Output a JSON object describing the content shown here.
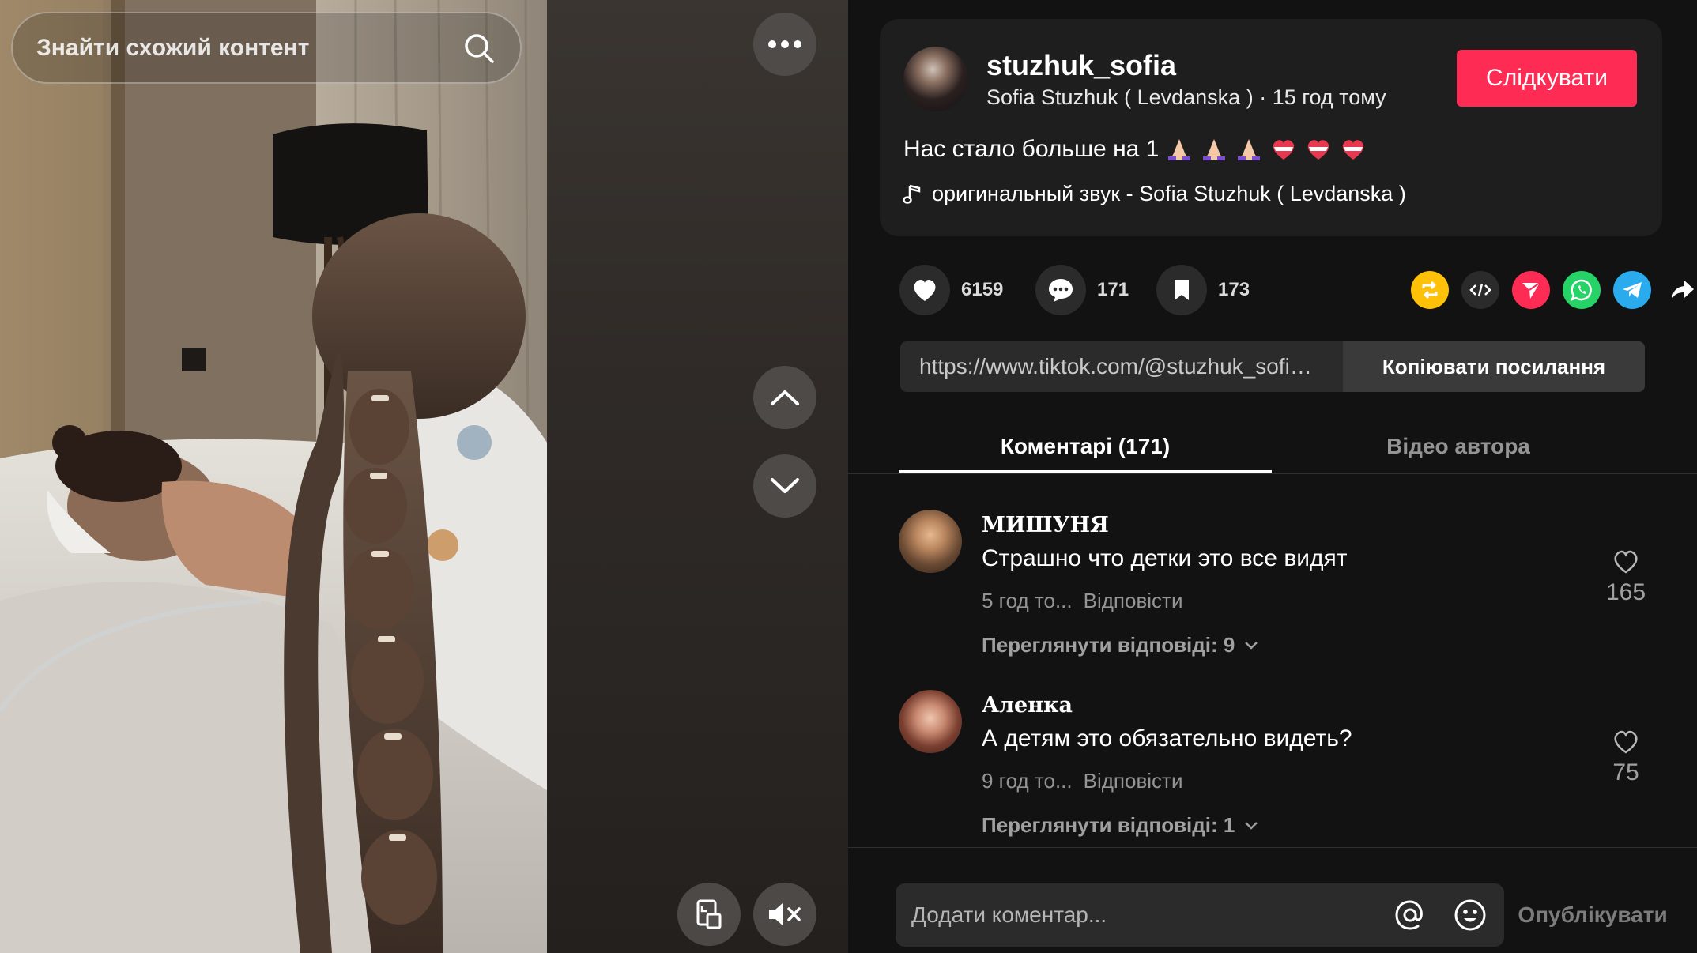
{
  "video": {
    "search_label": "Знайти схожий контент"
  },
  "post": {
    "username": "stuzhuk_sofia",
    "display_name": "Sofia Stuzhuk ( Levdanska )",
    "separator": " · ",
    "time_ago": "15 год тому",
    "follow_label": "Слідкувати",
    "caption": "Нас стало больше на 1",
    "music": "оригинальный звук - Sofia Stuzhuk ( Levdanska )"
  },
  "stats": {
    "likes": "6159",
    "comments": "171",
    "saves": "173"
  },
  "share": {
    "url": "https://www.tiktok.com/@stuzhuk_sofia/...",
    "copy_label": "Копіювати посилання"
  },
  "tabs": [
    {
      "label": "Коментарі (171)"
    },
    {
      "label": "Відео автора"
    }
  ],
  "comments": [
    {
      "name": "МИШУНЯ",
      "text": "Страшно что детки это все видят",
      "time": "5 год то...",
      "reply": "Відповісти",
      "view_replies": "Переглянути відповіді: 9",
      "likes": "165"
    },
    {
      "name": "Аленка",
      "text": "А детям это обязательно видеть?",
      "time": "9 год то...",
      "reply": "Відповісти",
      "view_replies": "Переглянути відповіді: 1",
      "likes": "75"
    }
  ],
  "composer": {
    "placeholder": "Додати коментар...",
    "post_label": "Опублікувати"
  },
  "colors": {
    "accent": "#fe2c55",
    "repost": "#ffc107",
    "share_red": "#fe2c55",
    "whatsapp": "#25d366",
    "telegram": "#2aabee"
  },
  "icons": [
    "search-icon",
    "more-icon",
    "chevron-up-icon",
    "chevron-down-icon",
    "pip-icon",
    "mute-icon",
    "heart-icon",
    "comment-icon",
    "bookmark-icon",
    "repost-icon",
    "embed-icon",
    "send-icon",
    "whatsapp-icon",
    "telegram-icon",
    "share-arrow-icon",
    "music-note-icon",
    "at-icon",
    "emoji-icon"
  ]
}
